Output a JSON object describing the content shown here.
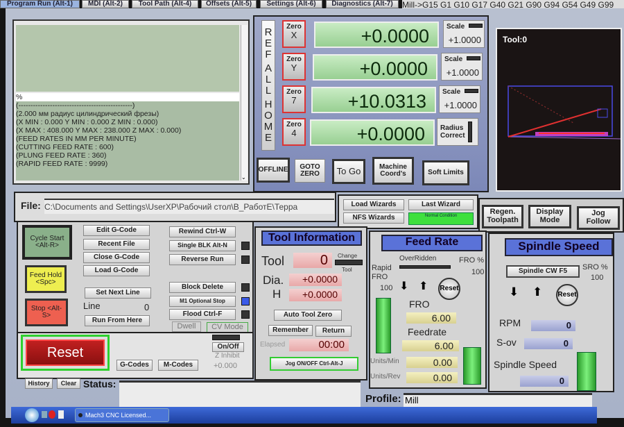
{
  "tabs": [
    "Program Run (Alt-1)",
    "MDI (Alt-2)",
    "Tool Path (Alt-4)",
    "Offsets (Alt-5)",
    "Settings (Alt-6)",
    "Diagnostics (Alt-7)"
  ],
  "modal_codes": "Mill->G15  G1 G10 G17 G40 G21 G90 G94 G54 G49 G99",
  "gcode_lines": [
    "%",
    "(-----------------------------------------------)",
    "(2.000 мм радиус цилиндрический фрезы)",
    "(X MIN : 0.000 Y MIN : 0.000 Z MIN : 0.000)",
    "(X MAX : 408.000 Y MAX : 238.000 Z MAX : 0.000)",
    "(FEED RATES IN MM PER MINUTE)",
    "(CUTTING FEED RATE : 600)",
    "(PLUNG FEED RATE : 360)",
    "(RAPID FEED RATE : 9999)"
  ],
  "ref_all_home": [
    "R",
    "E",
    "F",
    "A",
    "L",
    "L",
    "H",
    "O",
    "M",
    "E"
  ],
  "axes": [
    {
      "zero_label": "Zero",
      "axis": "X",
      "value": "+0.0000",
      "side_label": "Scale",
      "side_value": "+1.0000"
    },
    {
      "zero_label": "Zero",
      "axis": "Y",
      "value": "+0.0000",
      "side_label": "Scale",
      "side_value": "+1.0000"
    },
    {
      "zero_label": "Zero",
      "axis": "7",
      "value": "+10.0313",
      "side_label": "Scale",
      "side_value": "+1.0000"
    },
    {
      "zero_label": "Zero",
      "axis": "4",
      "value": "+0.0000",
      "side_label": "Radius Correct",
      "side_value": ""
    }
  ],
  "dro_buttons": [
    "OFFLINE",
    "GOTO ZERO",
    "To Go",
    "Machine Coord's",
    "Soft Limits"
  ],
  "toolpath": {
    "label": "Tool:0"
  },
  "file": {
    "label": "File:",
    "path": "C:\\Documents and Settings\\UserXP\\Рабочий стол\\В_РаботЕ\\Терра"
  },
  "wizards": {
    "load": "Load Wizards",
    "last": "Last Wizard",
    "nfs": "NFS Wizards",
    "normal": "Normal Condition"
  },
  "view_buttons": [
    "Regen. Toolpath",
    "Display Mode",
    "Jog Follow"
  ],
  "cycle": {
    "start": "Cycle Start <Alt-R>",
    "hold": "Feed Hold <Spc>",
    "stop": "Stop <Alt-S>"
  },
  "program_buttons": [
    "Edit G-Code",
    "Recent File",
    "Close G-Code",
    "Load G-Code",
    "Set Next Line",
    "Run From Here"
  ],
  "line": {
    "label": "Line",
    "value": "0"
  },
  "right_buttons": [
    "Rewind Ctrl-W",
    "Single BLK Alt-N",
    "Reverse Run",
    "Block Delete",
    "M1 Optional Stop",
    "Flood Ctrl-F"
  ],
  "dwell": "Dwell",
  "cv_mode": "CV Mode",
  "reset": "Reset",
  "gcodes": "G-Codes",
  "mcodes": "M-Codes",
  "onoff": "On/Off",
  "z_inhibit": "Z Inhibit",
  "z_inhibit_value": "+0.000",
  "tool_info": {
    "title": "Tool Information",
    "tool_label": "Tool",
    "tool": "0",
    "change": "Change",
    "change_tool": "Tool",
    "dia_label": "Dia.",
    "dia": "+0.0000",
    "h_label": "H",
    "h": "+0.0000",
    "auto_zero": "Auto Tool Zero",
    "remember": "Remember",
    "return": "Return",
    "elapsed_label": "Elapsed",
    "elapsed": "00:00",
    "jog": "Jog ON/OFF Ctrl-Alt-J"
  },
  "feed": {
    "title": "Feed Rate",
    "overridden": "OverRidden",
    "fro_pct_label": "FRO %",
    "fro_pct": "100",
    "rapid_label": "Rapid FRO",
    "rapid": "100",
    "reset": "Reset",
    "fro_label": "FRO",
    "fro": "6.00",
    "feedrate_label": "Feedrate",
    "feedrate": "6.00",
    "upm_label": "Units/Min",
    "upm": "0.00",
    "upr_label": "Units/Rev",
    "upr": "0.00"
  },
  "spindle": {
    "title": "Spindle Speed",
    "cw": "Spindle CW F5",
    "sro_label": "SRO %",
    "sro": "100",
    "reset": "Reset",
    "rpm_label": "RPM",
    "rpm": "0",
    "sov_label": "S-ov",
    "sov": "0",
    "speed_label": "Spindle Speed",
    "speed": "0"
  },
  "status": {
    "history": "History",
    "clear": "Clear",
    "label": "Status:",
    "value": ""
  },
  "profile": {
    "label": "Profile:",
    "value": "Mill"
  },
  "taskbar": {
    "app": "Mach3 CNC Licensed..."
  }
}
